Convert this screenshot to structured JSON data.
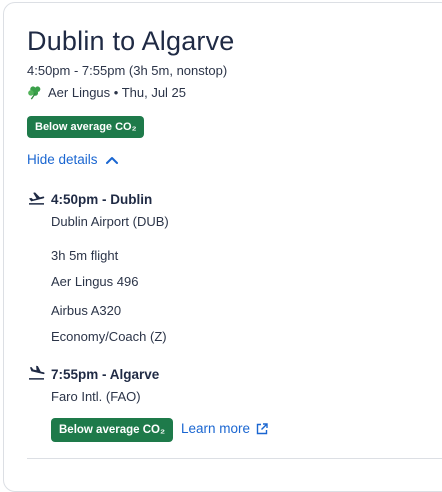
{
  "flight": {
    "title": "Dublin to Algarve",
    "summary": "4:50pm - 7:55pm (3h 5m, nonstop)",
    "airline_date": "Aer Lingus • Thu, Jul 25",
    "co2_badge": "Below average CO₂",
    "hide_details": "Hide details"
  },
  "departure": {
    "time_city": "4:50pm - Dublin",
    "airport": "Dublin Airport (DUB)",
    "icon": "takeoff-icon"
  },
  "details": {
    "duration": "3h 5m flight",
    "flight_number": "Aer Lingus 496",
    "aircraft": "Airbus A320",
    "cabin": "Economy/Coach (Z)"
  },
  "arrival": {
    "time_city": "7:55pm - Algarve",
    "airport": "Faro Intl. (FAO)",
    "icon": "landing-icon",
    "co2_badge": "Below average CO₂",
    "learn_more": "Learn more"
  },
  "colors": {
    "badge_green": "#1e7a4a",
    "link_blue": "#1a66d1",
    "shamrock_green": "#3aa04a"
  }
}
